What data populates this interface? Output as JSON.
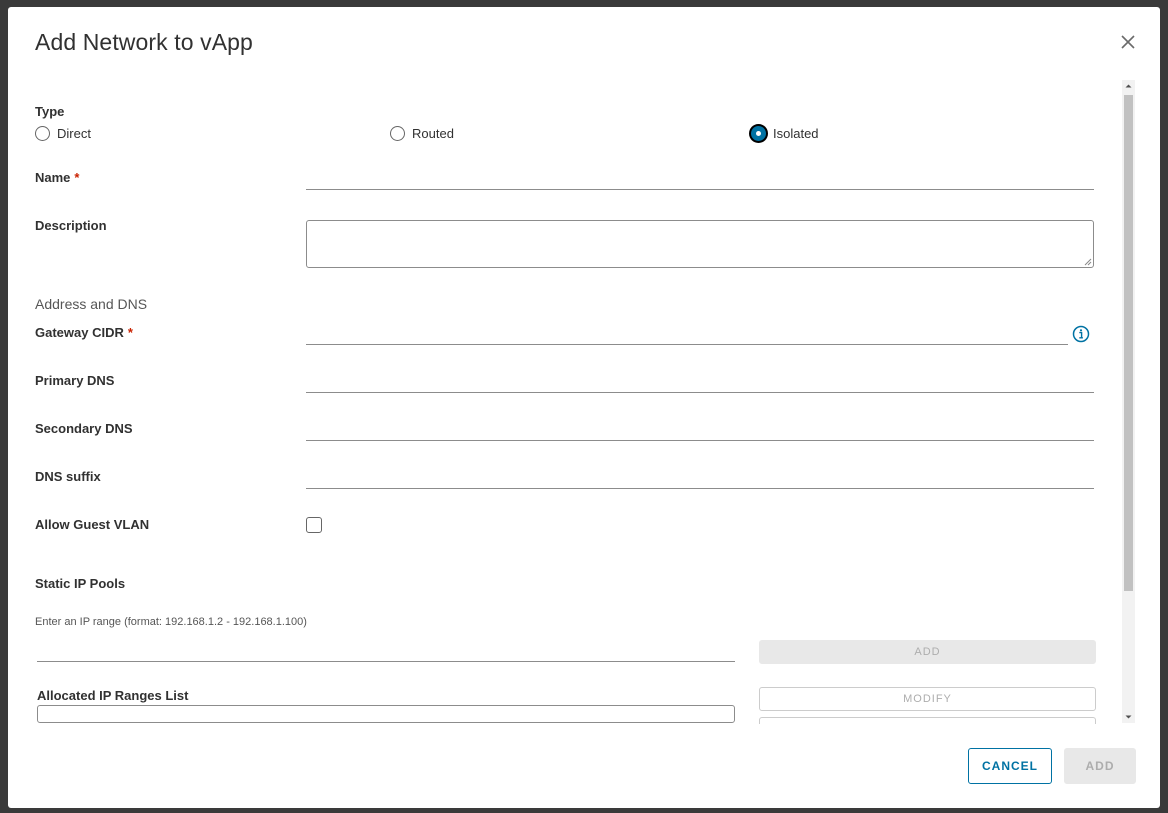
{
  "dialog": {
    "title": "Add Network to vApp",
    "close_icon": "close-icon"
  },
  "type_field": {
    "label": "Type",
    "options": [
      {
        "label": "Direct",
        "selected": false
      },
      {
        "label": "Routed",
        "selected": false
      },
      {
        "label": "Isolated",
        "selected": true
      }
    ]
  },
  "form": {
    "name_label": "Name",
    "name_value": "",
    "description_label": "Description",
    "description_value": "",
    "required_marker": "*",
    "address_section_title": "Address and DNS",
    "gateway_cidr_label": "Gateway CIDR",
    "gateway_info_icon": "info-icon",
    "primary_dns_label": "Primary DNS",
    "secondary_dns_label": "Secondary DNS",
    "dns_suffix_label": "DNS suffix",
    "allow_guest_vlan_label": "Allow Guest VLAN",
    "allow_guest_vlan_checked": false
  },
  "ip_pools": {
    "title": "Static IP Pools",
    "hint": "Enter an IP range (format: 192.168.1.2 - 192.168.1.100)",
    "add_label": "ADD",
    "allocated_label": "Allocated IP Ranges List",
    "modify_label": "MODIFY"
  },
  "footer": {
    "cancel_label": "CANCEL",
    "add_label": "ADD"
  },
  "colors": {
    "accent": "#0072a3",
    "required": "#c92100",
    "disabled_text": "#adadad"
  }
}
